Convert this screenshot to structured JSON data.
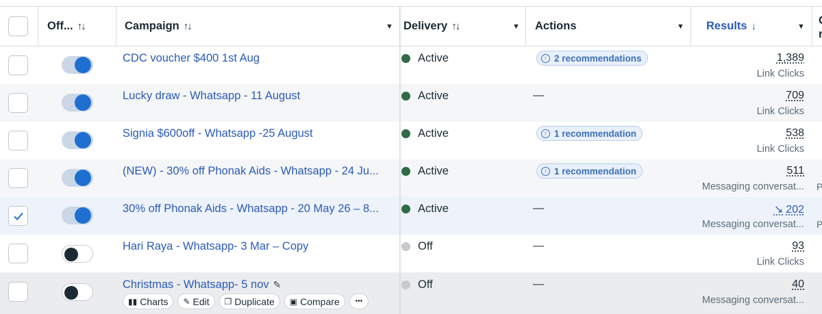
{
  "header": {
    "col_onoff": "Off...",
    "col_campaign": "Campaign",
    "col_delivery": "Delivery",
    "col_actions": "Actions",
    "col_results": "Results",
    "col_edge_top": "C",
    "col_edge_bottom": "r"
  },
  "rows": [
    {
      "name": "CDC voucher $400 1st Aug",
      "toggle": "on",
      "selected": false,
      "delivery": "Active",
      "rec": "2 recommendations",
      "result": "1,389",
      "result_sub": "Link Clicks",
      "edge": ""
    },
    {
      "name": "Lucky draw - Whatsapp - 11 August",
      "toggle": "on",
      "selected": false,
      "delivery": "Active",
      "rec": "",
      "dash": "—",
      "result": "709",
      "result_sub": "Link Clicks",
      "edge": ""
    },
    {
      "name": "Signia $600off - Whatsapp -25 August",
      "toggle": "on",
      "selected": false,
      "delivery": "Active",
      "rec": "1 recommendation",
      "result": "538",
      "result_sub": "Link Clicks",
      "edge": ""
    },
    {
      "name": "(NEW) - 30% off Phonak Aids - Whatsapp - 24 Ju...",
      "toggle": "on",
      "selected": false,
      "delivery": "Active",
      "rec": "1 recommendation",
      "result": "511",
      "result_sub": "Messaging conversat...",
      "edge": "P"
    },
    {
      "name": "30% off Phonak Aids - Whatsapp - 20 May 26 – 8...",
      "toggle": "on",
      "selected": true,
      "delivery": "Active",
      "rec": "",
      "dash": "—",
      "result": "202",
      "result_sub": "Messaging conversat...",
      "edge": "P"
    },
    {
      "name": "Hari Raya - Whatsapp- 3 Mar – Copy",
      "toggle": "off",
      "selected": false,
      "delivery": "Off",
      "rec": "",
      "dash": "—",
      "result": "93",
      "result_sub": "Link Clicks",
      "edge": ""
    },
    {
      "name": "Christmas - Whatsapp- 5 nov",
      "toggle": "off",
      "selected": false,
      "delivery": "Off",
      "rec": "",
      "dash": "—",
      "result": "40",
      "result_sub": "Messaging conversat...",
      "edge": ""
    }
  ],
  "row_actions": {
    "charts": "Charts",
    "edit": "Edit",
    "duplicate": "Duplicate",
    "compare": "Compare",
    "more": "•••"
  },
  "colors": {
    "link": "#2b5bb8",
    "active_dot": "#2e6b46",
    "off_dot": "#c7c9cc",
    "toggle_on": "#1f6fd1",
    "rec_bg": "#e8f0fb"
  }
}
